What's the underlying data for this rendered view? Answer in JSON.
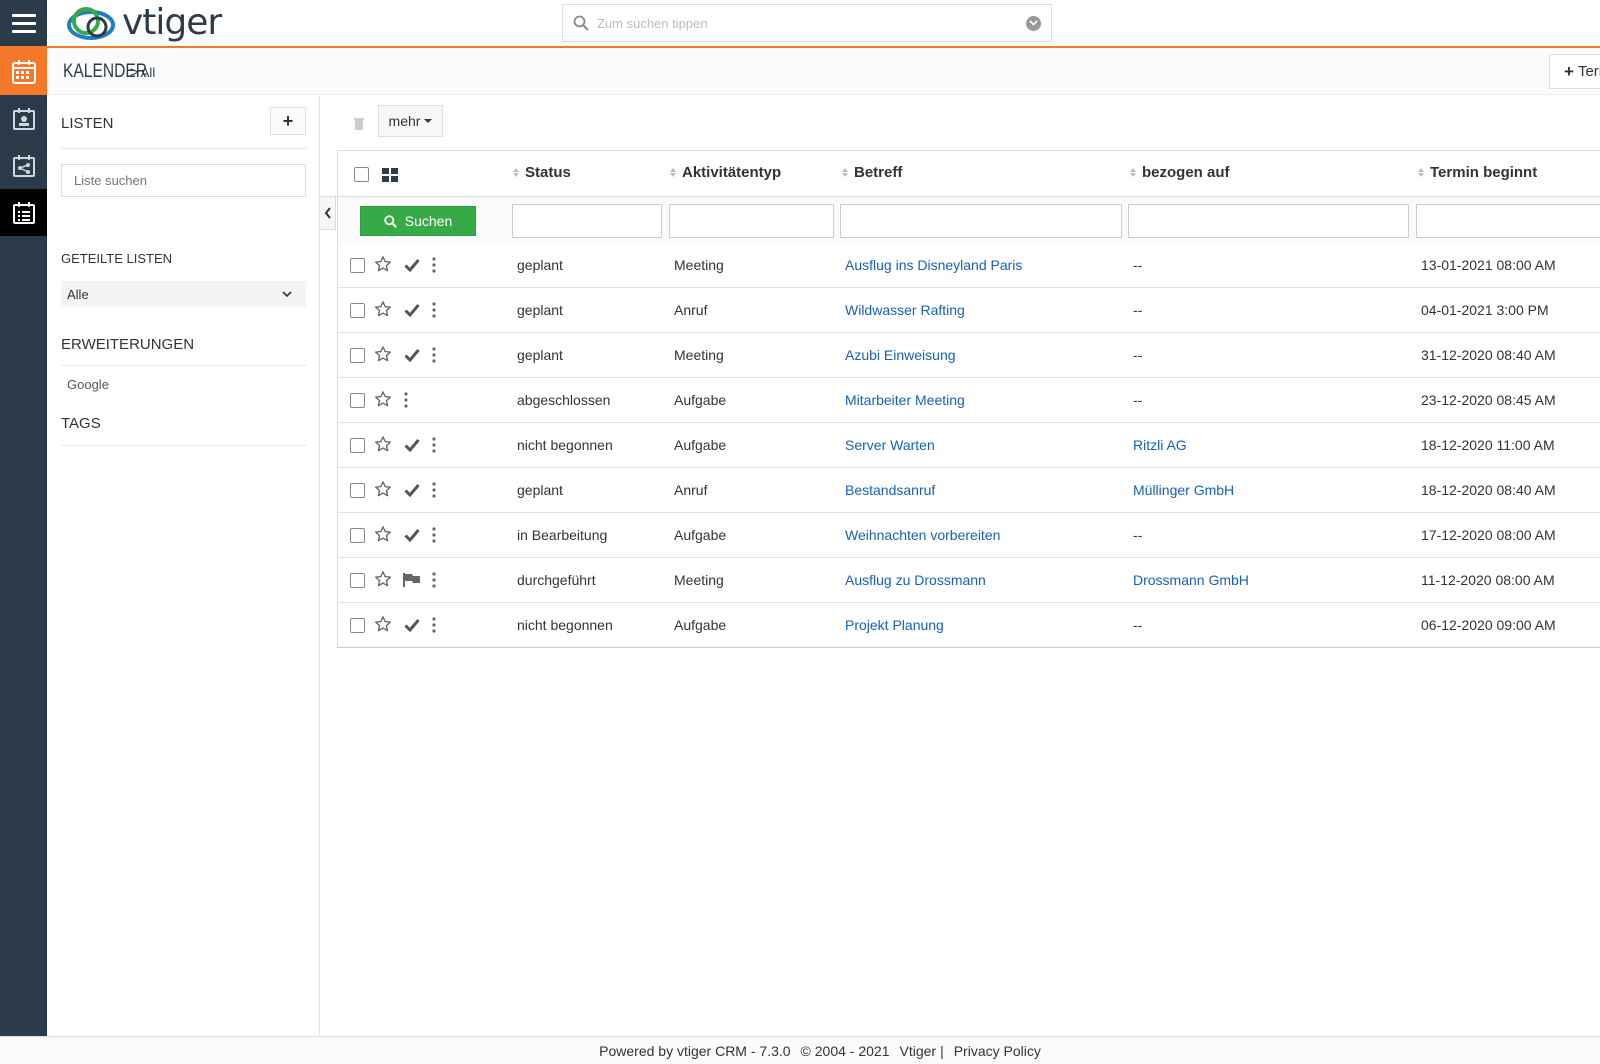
{
  "app": {
    "brand": "vtiger"
  },
  "search": {
    "placeholder": "Zum suchen tippen"
  },
  "module": {
    "title": "KALENDER",
    "separator": ">",
    "view": "All",
    "add_label": "Termin hi"
  },
  "sidebar": {
    "lists_title": "LISTEN",
    "add_icon": "+",
    "list_search_placeholder": "Liste suchen",
    "shared_title": "GETEILTE LISTEN",
    "shared_selected": "Alle",
    "extensions_title": "ERWEITERUNGEN",
    "extensions": [
      "Google"
    ],
    "tags_title": "TAGS"
  },
  "toolbar": {
    "more_label": "mehr"
  },
  "table": {
    "headers": [
      "Status",
      "Aktivitätentyp",
      "Betreff",
      "bezogen auf",
      "Termin beginnt"
    ],
    "search_label": "Suchen",
    "rows": [
      {
        "status": "geplant",
        "type": "Meeting",
        "subject": "Ausflug ins Disneyland Paris",
        "related": "--",
        "start": "13-01-2021 08:00 AM",
        "action": "check"
      },
      {
        "status": "geplant",
        "type": "Anruf",
        "subject": "Wildwasser Rafting",
        "related": "--",
        "start": "04-01-2021 3:00 PM",
        "action": "check"
      },
      {
        "status": "geplant",
        "type": "Meeting",
        "subject": "Azubi Einweisung",
        "related": "--",
        "start": "31-12-2020 08:40 AM",
        "action": "check"
      },
      {
        "status": "abgeschlossen",
        "type": "Aufgabe",
        "subject": "Mitarbeiter Meeting",
        "related": "--",
        "start": "23-12-2020 08:45 AM",
        "action": "none"
      },
      {
        "status": "nicht begonnen",
        "type": "Aufgabe",
        "subject": "Server Warten",
        "related": "Ritzli AG",
        "start": "18-12-2020 11:00 AM",
        "action": "check"
      },
      {
        "status": "geplant",
        "type": "Anruf",
        "subject": "Bestandsanruf",
        "related": "Müllinger GmbH",
        "start": "18-12-2020 08:40 AM",
        "action": "check"
      },
      {
        "status": "in Bearbeitung",
        "type": "Aufgabe",
        "subject": "Weihnachten vorbereiten",
        "related": "--",
        "start": "17-12-2020 08:00 AM",
        "action": "check"
      },
      {
        "status": "durchgeführt",
        "type": "Meeting",
        "subject": "Ausflug zu Drossmann",
        "related": "Drossmann GmbH",
        "start": "11-12-2020 08:00 AM",
        "action": "flag"
      },
      {
        "status": "nicht begonnen",
        "type": "Aufgabe",
        "subject": "Projekt Planung",
        "related": "--",
        "start": "06-12-2020 09:00 AM",
        "action": "check"
      }
    ]
  },
  "footer": {
    "powered": "Powered by vtiger CRM - 7.3.0",
    "copyright": "© 2004 - 2021",
    "vtiger_link": "Vtiger",
    "sep": "|",
    "privacy": "Privacy Policy"
  },
  "colors": {
    "accent": "#f4792b",
    "rail": "#2c3b49",
    "link": "#1560bd",
    "search_btn": "#35aa47"
  }
}
